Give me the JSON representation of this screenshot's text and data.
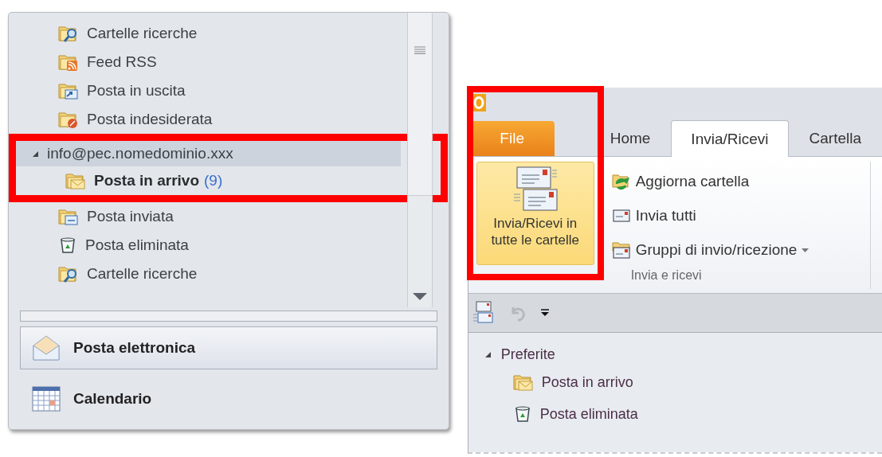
{
  "folder_pane": {
    "folders_before": [
      {
        "label": "Cartelle ricerche",
        "kind": "search"
      },
      {
        "label": "Feed RSS",
        "kind": "rss"
      },
      {
        "label": "Posta in uscita",
        "kind": "outbox"
      },
      {
        "label": "Posta indesiderata",
        "kind": "junk"
      }
    ],
    "account": {
      "label": "info@pec.nomedominio.xxx",
      "expanded": true
    },
    "account_folders": [
      {
        "label": "Posta in arrivo",
        "count": "(9)",
        "kind": "inbox"
      }
    ],
    "folders_after": [
      {
        "label": "Posta inviata",
        "kind": "sent"
      },
      {
        "label": "Posta eliminata",
        "kind": "trash"
      },
      {
        "label": "Cartelle ricerche",
        "kind": "search"
      }
    ],
    "nav_buttons": [
      {
        "label": "Posta elettronica",
        "kind": "mail",
        "selected": true
      },
      {
        "label": "Calendario",
        "kind": "calendar",
        "selected": false
      }
    ]
  },
  "ribbon": {
    "tabs": [
      {
        "label": "File",
        "kind": "file",
        "selected": false
      },
      {
        "label": "Home",
        "kind": "tab",
        "selected": false
      },
      {
        "label": "Invia/Ricevi",
        "kind": "tab",
        "selected": true
      },
      {
        "label": "Cartella",
        "kind": "tab",
        "selected": false
      }
    ],
    "big_button": {
      "label": "Invia/Ricevi in tutte le cartelle"
    },
    "small_buttons": [
      {
        "label": "Aggiorna cartella",
        "kind": "refresh",
        "dropdown": false
      },
      {
        "label": "Invia tutti",
        "kind": "send",
        "dropdown": false
      },
      {
        "label": "Gruppi di invio/ricezione",
        "kind": "groups",
        "dropdown": true
      }
    ],
    "group_label": "Invia e ricevi"
  },
  "favorites": {
    "label": "Preferite",
    "expanded": true,
    "items": [
      {
        "label": "Posta in arrivo",
        "kind": "inbox"
      },
      {
        "label": "Posta eliminata",
        "kind": "trash"
      }
    ]
  }
}
